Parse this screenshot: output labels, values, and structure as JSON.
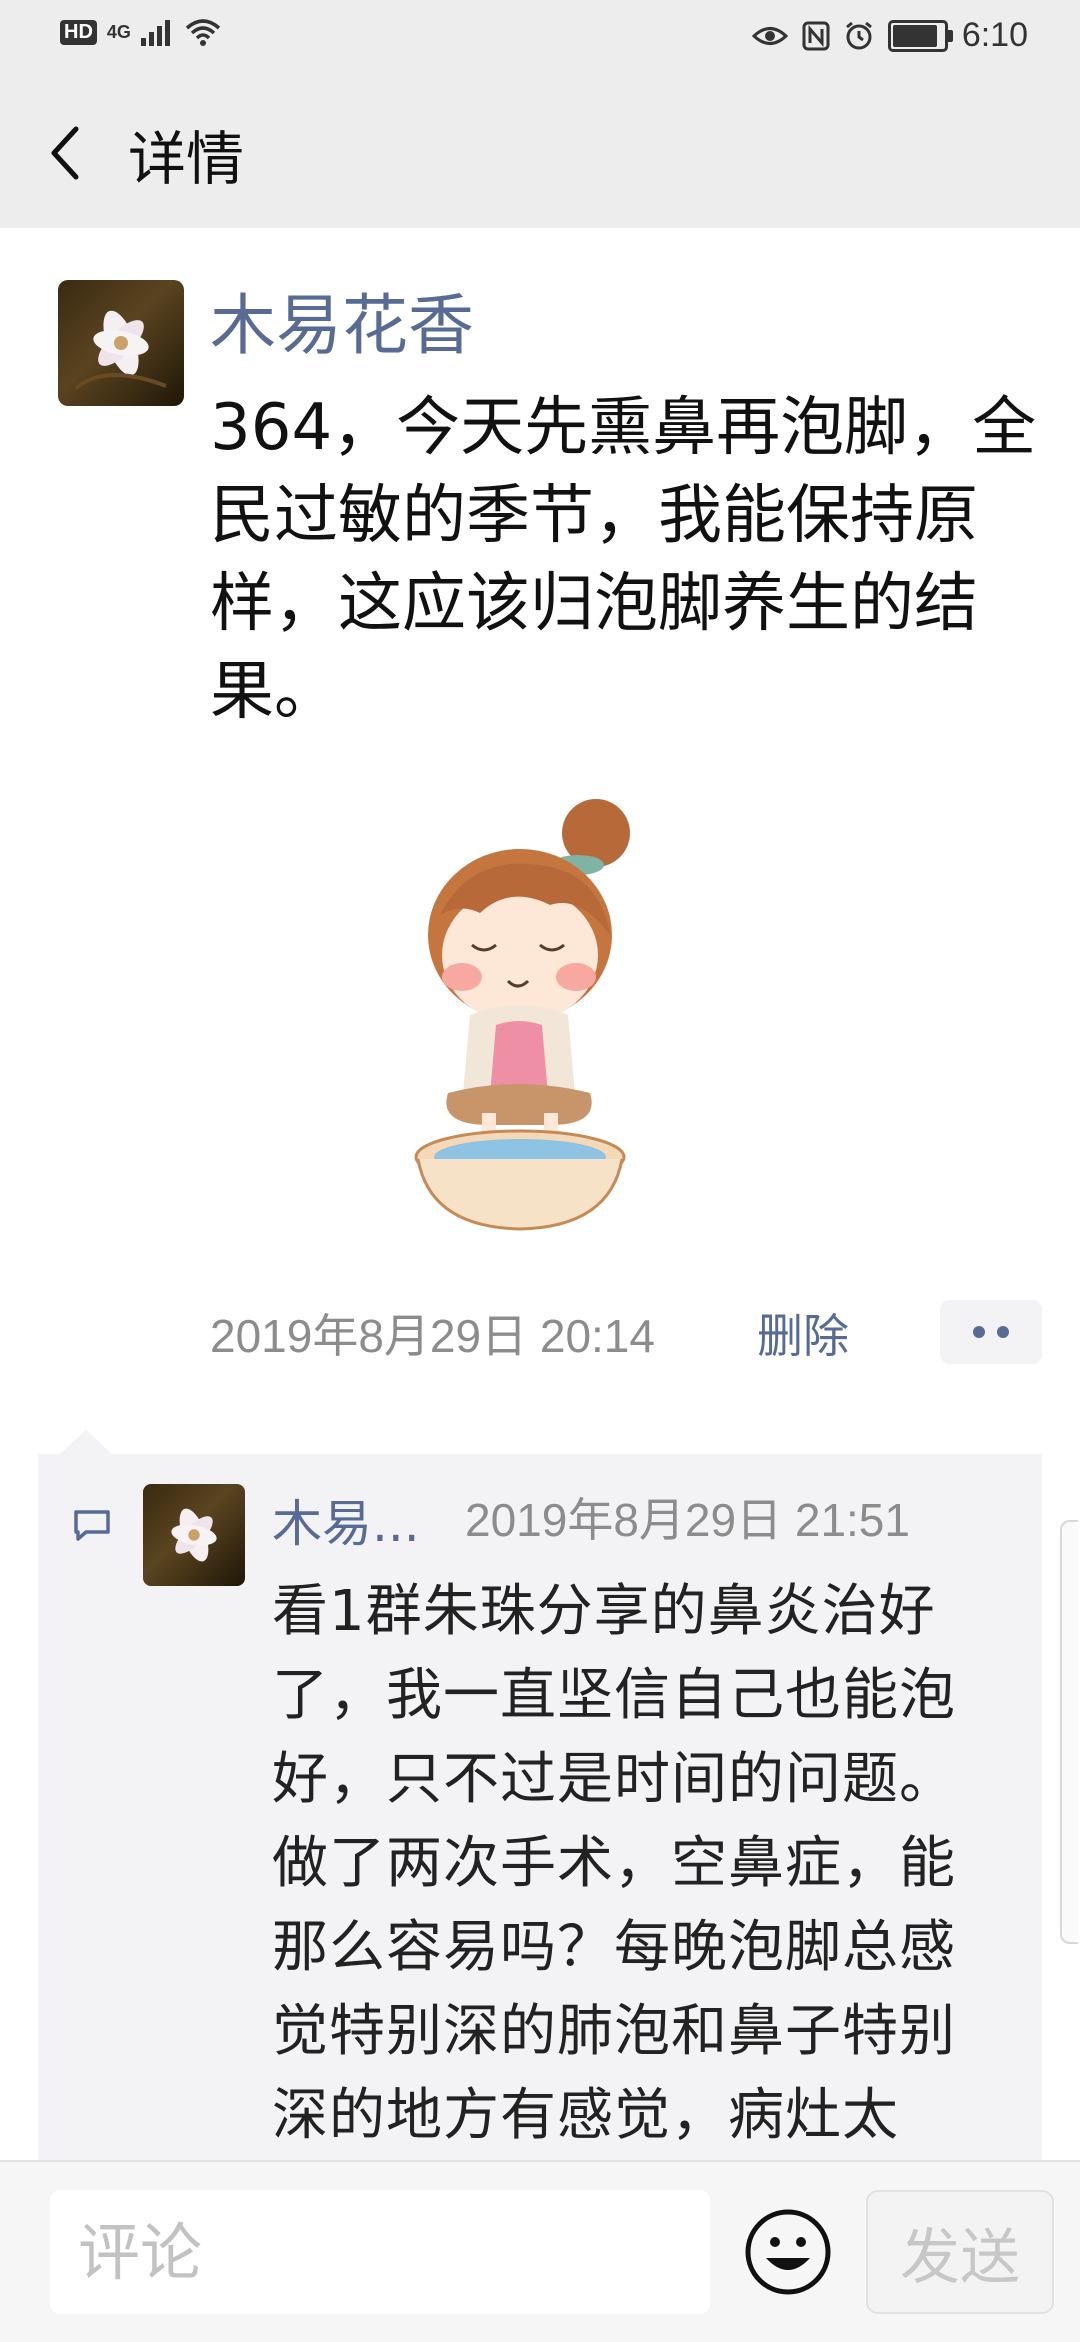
{
  "status_bar": {
    "hd": "HD",
    "network": "4G",
    "time": "6:10",
    "battery_level": 0.9
  },
  "header": {
    "title": "详情"
  },
  "post": {
    "author": "木易花香",
    "text": "364，今天先熏鼻再泡脚，全民过敏的季节，我能保持原样，这应该归泡脚养生的结果。",
    "timestamp": "2019年8月29日 20:14",
    "delete_label": "删除"
  },
  "comment": {
    "author": "木易...",
    "time": "2019年8月29日 21:51",
    "text": "看1群朱珠分享的鼻炎治好了，我一直坚信自己也能泡好，只不过是时间的问题。做了两次手术，空鼻症，能那么容易吗？每晚泡脚总感觉特别深的肺泡和鼻子特别深的地方有感觉，病灶太深，慢慢修"
  },
  "input_bar": {
    "placeholder": "评论",
    "send_label": "发送"
  },
  "colors": {
    "link": "#576b95",
    "header_bg": "#ededed",
    "comment_bg": "#f3f3f5"
  }
}
